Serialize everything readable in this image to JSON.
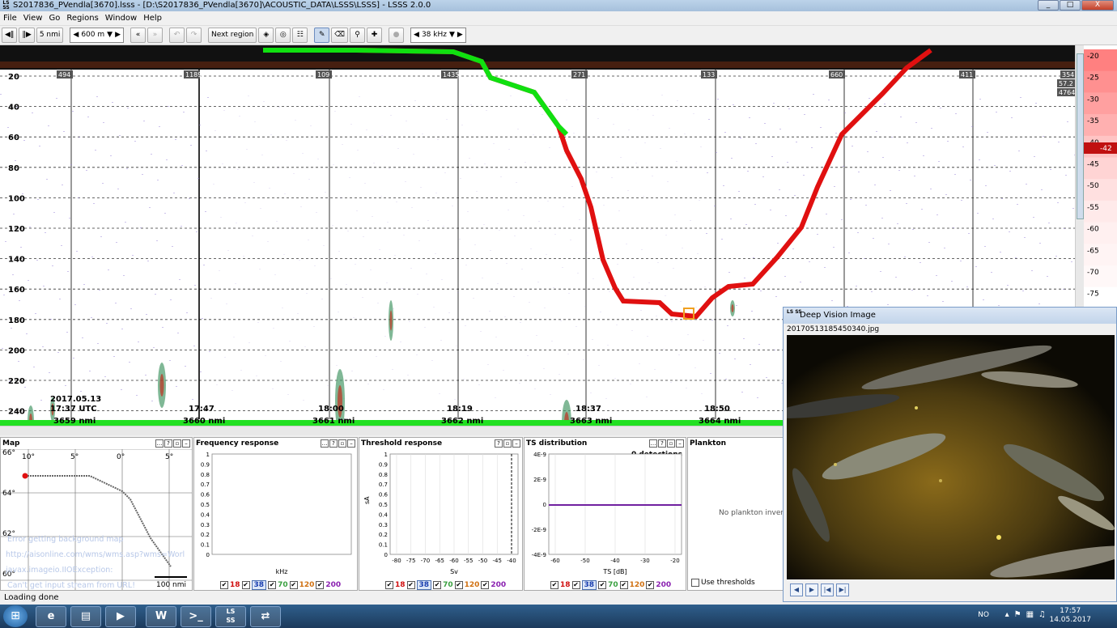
{
  "window": {
    "title": "S2017836_PVendla[3670].lsss - [D:\\S2017836_PVendla[3670]\\ACOUSTIC_DATA\\LSSS\\LSSS] - LSSS 2.0.0",
    "app_icon": "LS SS",
    "controls": [
      "_",
      "□",
      "X"
    ]
  },
  "menu": [
    "File",
    "View",
    "Go",
    "Regions",
    "Window",
    "Help"
  ],
  "toolbar": {
    "step_label": "5 nmi",
    "range_value": "600 m",
    "next_region_label": "Next region",
    "frequency_value": "38 kHz"
  },
  "echogram": {
    "depth_ticks": [
      "20",
      "40",
      "60",
      "80",
      "100",
      "120",
      "140",
      "160",
      "180",
      "200",
      "220",
      "240"
    ],
    "ping_counts": [
      "494",
      "1189",
      "109",
      "1435",
      "271",
      "133",
      "660",
      "411",
      "354"
    ],
    "right_labels": [
      "57.2",
      "4764"
    ],
    "date_label": "2017.05.13",
    "time_labels": [
      "17:37 UTC",
      "17:47",
      "18:00",
      "18:19",
      "18:37",
      "18:50"
    ],
    "distance_labels": [
      "3659 nmi",
      "3660 nmi",
      "3661 nmi",
      "3662 nmi",
      "3663 nmi",
      "3664 nmi"
    ]
  },
  "colorbar": {
    "ticks": [
      "-20",
      "-25",
      "-30",
      "-35",
      "-40",
      "-45",
      "-50",
      "-55",
      "-60",
      "-65",
      "-70",
      "-75"
    ],
    "current": "-42"
  },
  "panels": {
    "map": {
      "title": "Map",
      "lon_labels": [
        "10°",
        "5°",
        "0°",
        "5°"
      ],
      "lat_labels": [
        "66°",
        "64°",
        "62°",
        "60°"
      ],
      "error_lines": [
        "Error getting background map",
        "http://aisonline.com/wms/wms.asp?wms=Worl",
        "javax.imageio.IIOException:",
        "Can't get input stream from URL!"
      ],
      "scale": "100 nmi"
    },
    "frequency": {
      "title": "Frequency response",
      "y_ticks": [
        "1",
        "0.9",
        "0.8",
        "0.7",
        "0.6",
        "0.5",
        "0.4",
        "0.3",
        "0.2",
        "0.1",
        "0"
      ],
      "x_label": "kHz"
    },
    "threshold": {
      "title": "Threshold response",
      "y_ticks": [
        "1",
        "0.9",
        "0.8",
        "0.7",
        "0.6",
        "0.5",
        "0.4",
        "0.3",
        "0.2",
        "0.1",
        "0"
      ],
      "y_label": "sA",
      "x_ticks": [
        "-80",
        "-75",
        "-70",
        "-65",
        "-60",
        "-55",
        "-50",
        "-45",
        "-40"
      ],
      "x_label": "Sv"
    },
    "ts": {
      "title": "TS distribution",
      "detections": "0 detections",
      "y_ticks": [
        "4E-9",
        "2E-9",
        "0",
        "-2E-9",
        "-4E-9"
      ],
      "x_ticks": [
        "-60",
        "-50",
        "-40",
        "-30",
        "-20"
      ],
      "x_label": "TS [dB]"
    },
    "plankton": {
      "title": "Plankton",
      "message": "No plankton inversi",
      "checkbox_label": "Use thresholds"
    }
  },
  "frequencies": [
    {
      "label": "18",
      "color": "#d01010",
      "selected": false
    },
    {
      "label": "38",
      "color": "#1a3fb0",
      "selected": true
    },
    {
      "label": "70",
      "color": "#3aa040",
      "selected": false
    },
    {
      "label": "120",
      "color": "#d07010",
      "selected": false
    },
    {
      "label": "200",
      "color": "#8a20b0",
      "selected": false
    }
  ],
  "status": "Loading done",
  "deep_vision": {
    "title": "Deep Vision Image",
    "filename": "20170513185450340.jpg"
  },
  "taskbar": {
    "lang": "NO",
    "time": "17:57",
    "date": "14.05.2017"
  }
}
